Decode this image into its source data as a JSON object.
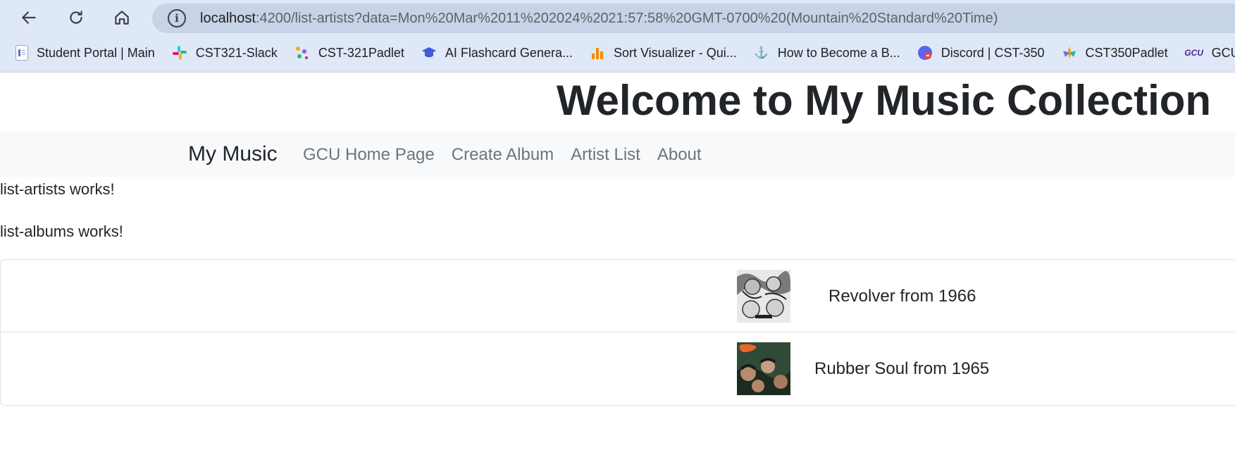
{
  "browser": {
    "url_host": "localhost",
    "url_rest": ":4200/list-artists?data=Mon%20Mar%2011%202024%2021:57:58%20GMT-0700%20(Mountain%20Standard%20Time)",
    "bookmarks": [
      {
        "label": "Student Portal | Main",
        "icon": "document-icon"
      },
      {
        "label": "CST321-Slack",
        "icon": "slack-icon"
      },
      {
        "label": "CST-321Padlet",
        "icon": "padlet-icon"
      },
      {
        "label": "AI Flashcard Genera...",
        "icon": "graduation-cap-icon"
      },
      {
        "label": "Sort Visualizer - Qui...",
        "icon": "bar-chart-icon"
      },
      {
        "label": "How to Become a B...",
        "icon": "geeksforgeeks-icon"
      },
      {
        "label": "Discord | CST-350",
        "icon": "discord-icon"
      },
      {
        "label": "CST350Padlet",
        "icon": "padlet-icon"
      },
      {
        "label": "GCU Co",
        "icon": "gcu-icon"
      }
    ]
  },
  "page": {
    "title": "Welcome to My Music Collection",
    "brand": "My Music",
    "nav": [
      "GCU Home Page",
      "Create Album",
      "Artist List",
      "About"
    ],
    "messages": [
      "list-artists works!",
      "list-albums works!"
    ],
    "albums": [
      {
        "label": "Revolver from 1966"
      },
      {
        "label": "Rubber Soul from 1965"
      }
    ]
  },
  "colors": {
    "chrome_bg": "#dfe8f7",
    "omnibox_bg": "#c7d3e6",
    "navbar_bg": "#f8f9fa",
    "nav_link": "#6c757d",
    "text": "#212529"
  }
}
